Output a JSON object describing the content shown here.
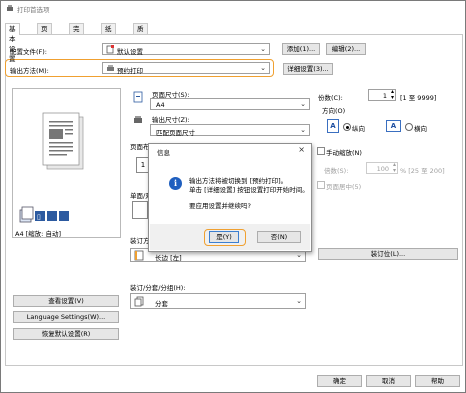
{
  "window": {
    "title": "打印首选项"
  },
  "tabs": [
    "基本设置",
    "页面设置",
    "完成方式",
    "纸张来源",
    "质量"
  ],
  "profile": {
    "label": "配置文件(F):",
    "value": "默认设置",
    "add_label": "添加(1)...",
    "edit_label": "编辑(2)..."
  },
  "output": {
    "label": "输出方法(M):",
    "value": "预约打印",
    "detail_label": "详细设置(3)..."
  },
  "preview": {
    "caption": "A4 [缩放: 自动]",
    "view_button": "查看设置(V)",
    "language_button": "Language Settings(W)...",
    "restore_button": "恢复默认设置(R)"
  },
  "page": {
    "page_size_label": "页面尺寸(S):",
    "page_size_value": "A4",
    "output_size_label": "输出尺寸(Z):",
    "output_size_value": "匹配页面尺寸",
    "layout_label": "页面布局",
    "layout_value": "1",
    "copies_label": "份数(C):",
    "copies_value": "1",
    "copies_range": "[1 至 9999]",
    "orientation_label": "方向(O)",
    "portrait": "纵向",
    "landscape": "横向",
    "manual_scale": "手动缩放(N)",
    "scale_label": "倍数(S):",
    "scale_value": "100",
    "scale_range": "% [25 至 200]",
    "center_print": "页面居中(5)"
  },
  "duplex": {
    "label": "单面/双",
    "binding_label": "装订方向",
    "binding_value": "长边 [左]",
    "binding_button": "装订位(L)..."
  },
  "finishing": {
    "label": "装订/分套/分组(H):",
    "value": "分套"
  },
  "footer": {
    "ok": "确定",
    "cancel": "取消",
    "apply": "应用",
    "help": "帮助"
  },
  "dialog": {
    "title": "信息",
    "close": "×",
    "message_line1": "输出方法将被切换到 [预约打印]。",
    "message_line2": "单击 [详细设置] 按钮设置打印开始时间。",
    "message_line3": "要应用设置并继续吗?",
    "yes": "是(Y)",
    "no": "否(N)"
  },
  "colors": {
    "highlight": "#f0a030",
    "info": "#1f5fbf"
  }
}
